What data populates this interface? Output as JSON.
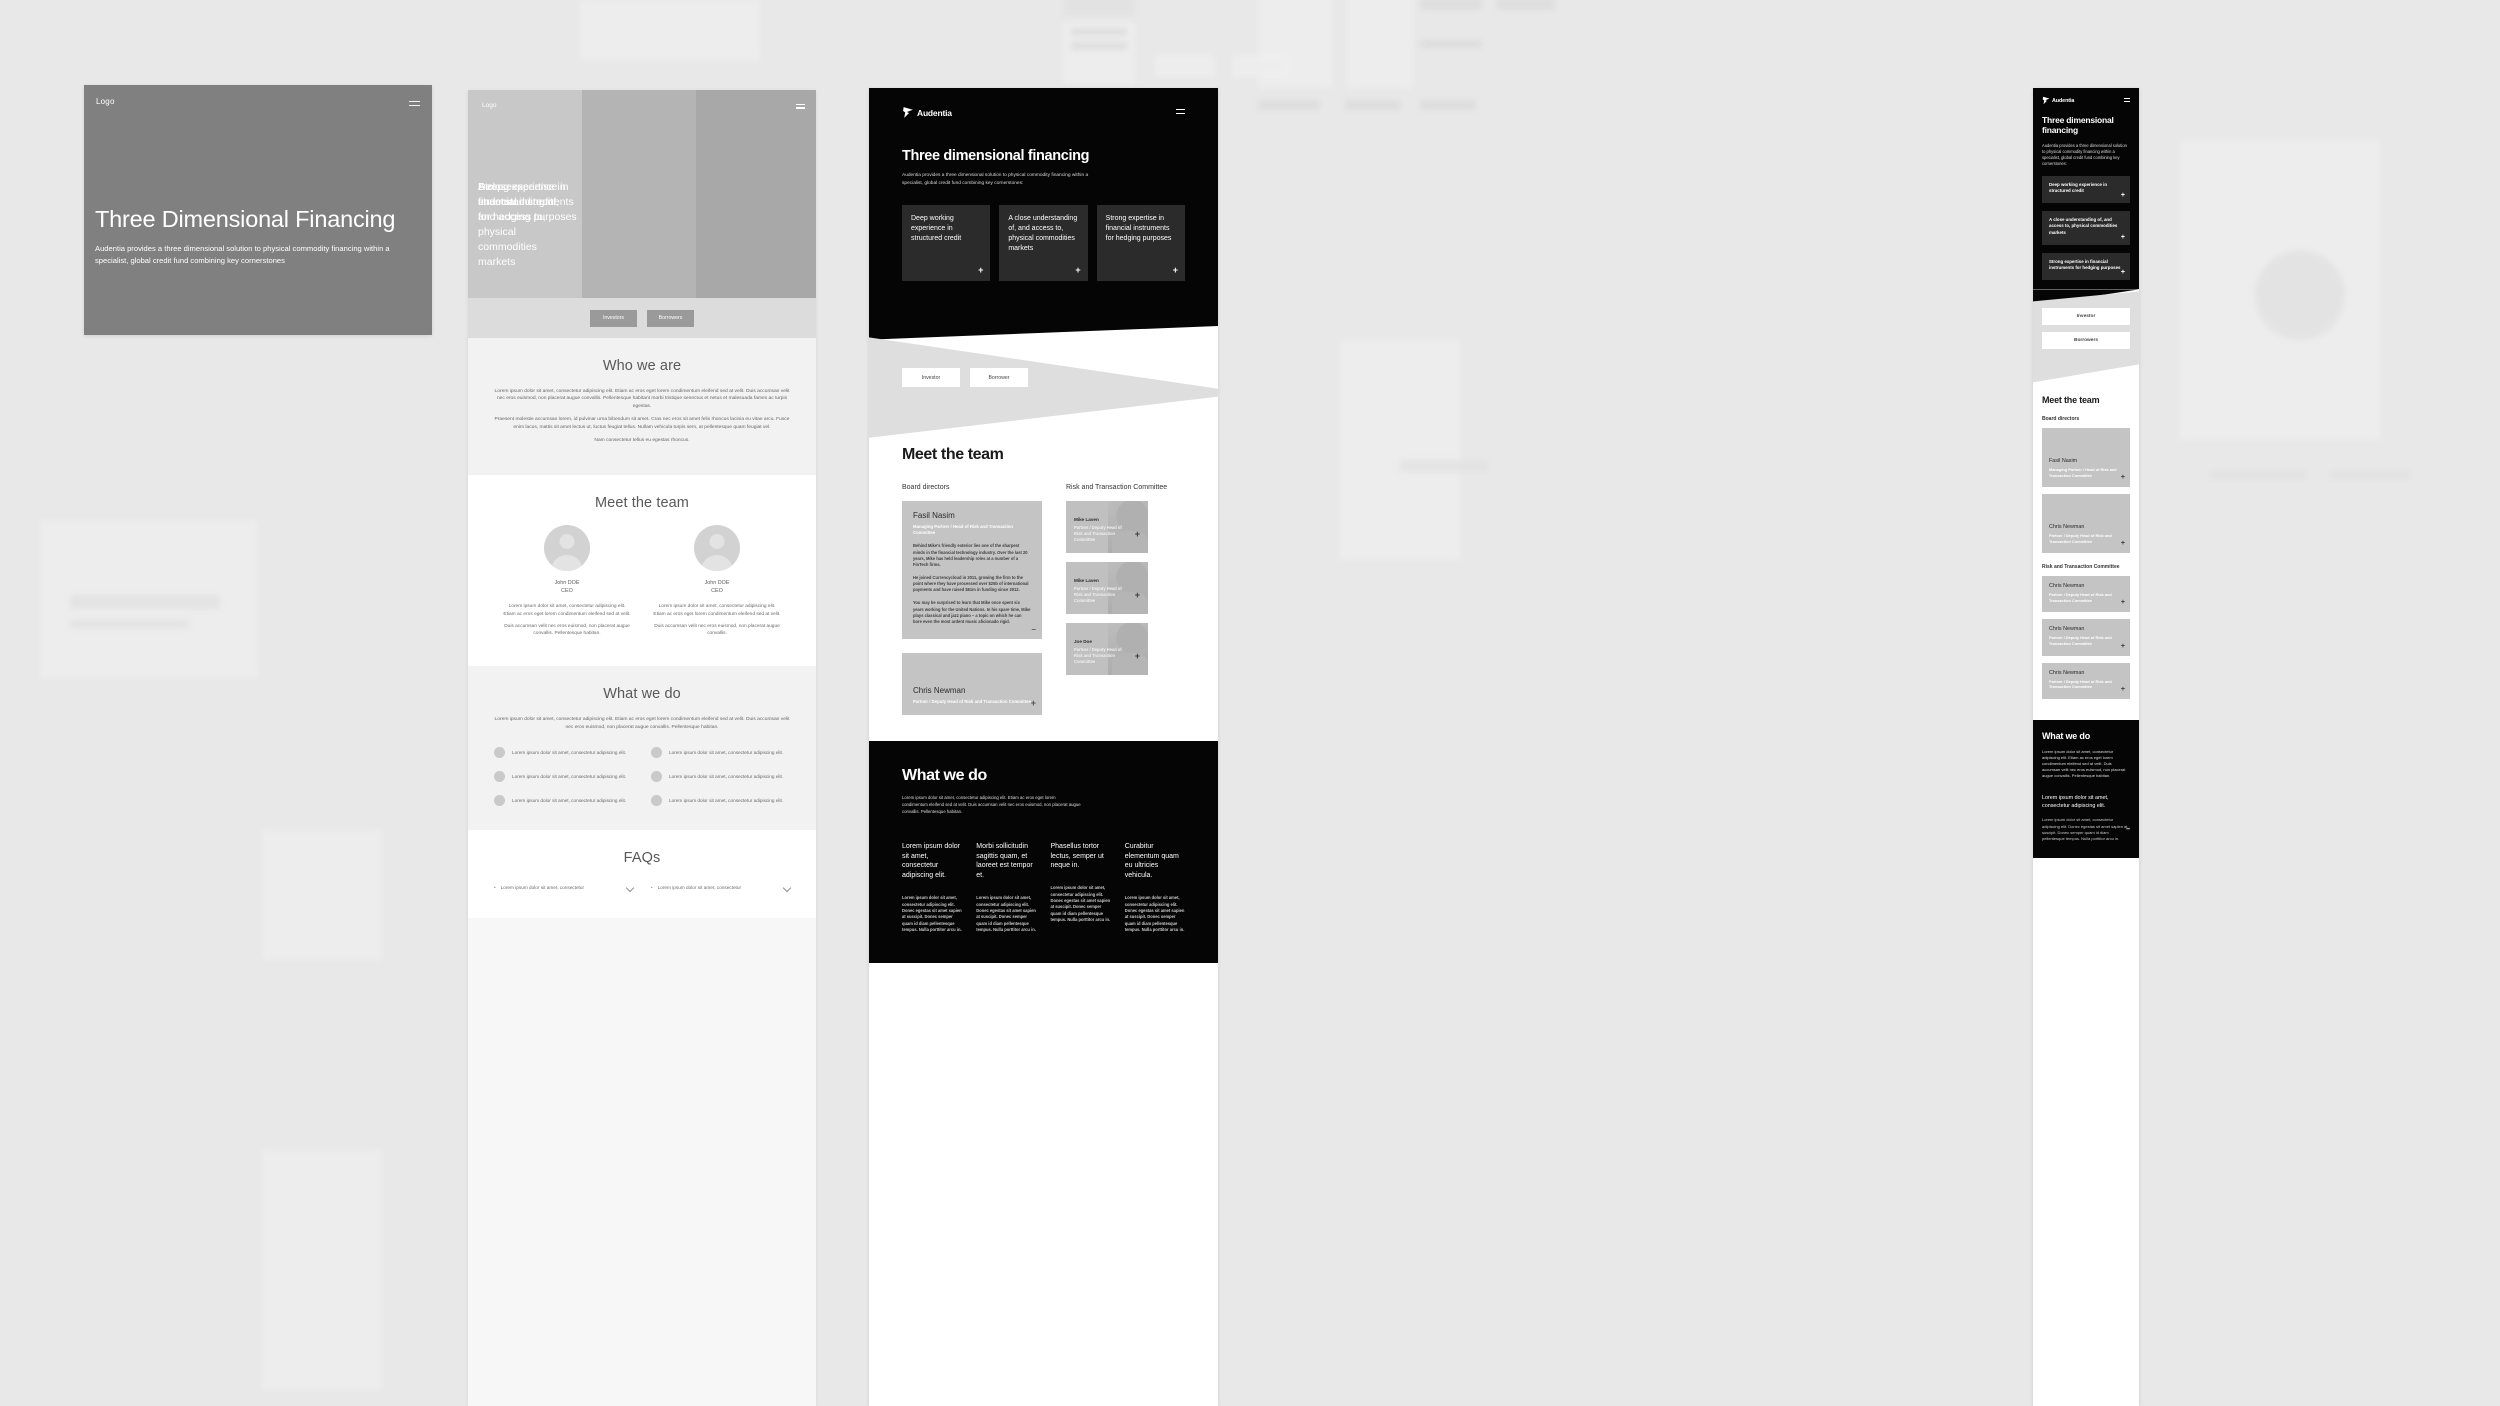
{
  "hero_desktop": {
    "logo": "Logo",
    "menu_icon": "hamburger-menu-icon",
    "title": "Three Dimensional Financing",
    "subtitle": "Audentia provides a three dimensional solution to physical commodity financing within a specialist, global credit fund combining key cornerstones"
  },
  "tablet": {
    "logo": "Logo",
    "menu_icon": "hamburger-menu-icon",
    "columns": [
      "Deep experience in structured credit",
      "A close understanding of, and access to, physical commodities markets",
      "Strong expertise in financial instruments for hedging purposes"
    ],
    "cta": {
      "investors": "Investors",
      "borrowers": "Borrowers"
    },
    "who_we_are": {
      "heading": "Who we are",
      "paragraphs": [
        "Lorem ipsum dolor sit amet, consectetur adipiscing elit. Etiam ac eros eget lorem condimentum eleifend sed at velit. Duis accumsan velit nec eros euismod, non placerat augue convallis. Pellentesque habitant morbi tristique senectus et netus et malesuada fames ac turpis egestas.",
        "Praesent molestie accumsan lorem, id pulvinar urna bibendum sit amet. Cras nec eros sit amet felis rhoncus lacinia eu vitae arcu. Fusce enim lacus, mattis sit amet lectus ut, luctus feugiat tellus. Nullam vehicula turpis sem, at pellentesque quam feugiat vel.",
        "Nam consectetur tellus eu egestas rhoncus."
      ]
    },
    "meet_the_team": {
      "heading": "Meet the team",
      "members": [
        {
          "name": "John DOE",
          "role": "CEO",
          "bio1": "Lorem ipsum dolor sit amet, consectetur adipiscing elit. Etiam ac eros eget lorem condimentum eleifend sed at velit.",
          "bio2": "Duis accumsan velit nec eros euismod, non placerat augue convallis. Pellentesque habitan."
        },
        {
          "name": "John DOE",
          "role": "CEO",
          "bio1": "Lorem ipsum dolor sit amet, consectetur adipiscing elit. Etiam ac eros eget lorem condimentum eleifend sed at velit.",
          "bio2": "Duis accumsan velit nec eros euismod, non placerat augue convallis."
        }
      ]
    },
    "what_we_do": {
      "heading": "What we do",
      "lead": "Lorem ipsum dolor sit amet, consectetur adipiscing elit. Etiam ac eros eget lorem condimentum eleifend sed at velit. Duis accumsan velit nec eros euismod, non placerat augue convallis. Pellentesque habitan.",
      "bullets": [
        "Lorem ipsum dolor sit amet, consectetur adipiscing elit.",
        "Lorem ipsum dolor sit amet, consectetur adipiscing elit.",
        "Lorem ipsum dolor sit amet, consectetur adipiscing elit.",
        "Lorem ipsum dolor sit amet, consectetur adipiscing elit.",
        "Lorem ipsum dolor sit amet, consectetur adipiscing elit.",
        "Lorem ipsum dolor sit amet, consectetur adipiscing elit."
      ]
    },
    "faqs": {
      "heading": "FAQs",
      "items": [
        "Lorem ipsum dolor sit amet, consectetur",
        "Lorem ipsum dolor sit amet, consectetur"
      ]
    }
  },
  "desktop_dark": {
    "brand": "Audentia",
    "logo_icon": "audentia-bird-logo-icon",
    "menu_icon": "hamburger-menu-icon",
    "title": "Three dimensional financing",
    "subtitle": "Audentia provides a three dimensional solution to physical commodity financing within a specialist, global credit fund combining key cornerstones:",
    "cards": [
      "Deep working experience in structured credit",
      "A close understanding of, and access to, physical commodities markets",
      "Strong expertise in financial instruments for hedging purposes"
    ],
    "buttons": {
      "investor": "Investor",
      "borrower": "Borrower"
    },
    "team": {
      "heading": "Meet the team",
      "board_label": "Board directors",
      "risk_label": "Risk and Transaction Committee",
      "featured": {
        "name": "Fasil Nasim",
        "role": "Managing Partner / Head of Risk and Transaction Committee",
        "bio": [
          "Behind Mike's friendly exterior lies one of the sharpest minds in the financial technology industry. Over the last 20 years, Mike has held leadership roles at a number of a FinTech firms.",
          "He joined Currencycloud in 2011, growing the firm to the point where they have processed over $25b of international payments and have raised $61m in funding since 2012.",
          "You may be surprised to learn that Mike once spent six years working for the United Nations. In his spare time, Mike plays classical and jazz piano – a topic on which he can bore even the most ardent music aficionado rigid."
        ]
      },
      "board_second": {
        "name": "Chris Newman",
        "role": "Partner / Deputy Head of Risk and Transaction Committee"
      },
      "committee": [
        {
          "name": "Mike Laven",
          "role": "Partner / Deputy Head of Risk and Transaction Committee"
        },
        {
          "name": "Mike Laven",
          "role": "Partner / Deputy Head of Risk and Transaction Committee"
        },
        {
          "name": "Joe Doe",
          "role": "Partner / Deputy Head of Risk and Transaction Committee"
        }
      ]
    },
    "what_we_do": {
      "heading": "What we do",
      "lead": "Lorem ipsum dolor sit amet, consectetur adipiscing elit. Etiam ac eros eget lorem condimentum eleifend sed at velit. Duis accumsan velit nec eros euismod, non placerat augue convallis. Pellentesque habitan.",
      "items": [
        {
          "title": "Lorem ipsum dolor sit amet, consectetur adipiscing elit.",
          "body": "Lorem ipsum dolor sit amet, consectetur adipiscing elit. Donec egestas sit amet sapien at suscipit. Donec semper quam id diam pellentesque tempus. Nulla porttitor arcu in."
        },
        {
          "title": "Morbi sollicitudin sagittis quam, et laoreet est tempor et.",
          "body": "Lorem ipsum dolor sit amet, consectetur adipiscing elit. Donec egestas sit amet sapien at suscipit. Donec semper quam id diam pellentesque tempus. Nulla porttitor arcu in."
        },
        {
          "title": "Phasellus tortor lectus, semper ut neque in.",
          "body": "Lorem ipsum dolor sit amet, consectetur adipiscing elit. Donec egestas sit amet sapien at suscipit. Donec semper quam id diam pellentesque tempus. Nulla porttitor arcu in."
        },
        {
          "title": "Curabitur elementum quam eu ultricies vehicula.",
          "body": "Lorem ipsum dolor sit amet, consectetur adipiscing elit. Donec egestas sit amet sapien at suscipit. Donec semper quam id diam pellentesque tempus. Nulla porttitor arcu in."
        }
      ]
    }
  },
  "mobile_dark": {
    "brand": "Audentia",
    "logo_icon": "audentia-bird-logo-icon",
    "menu_icon": "hamburger-menu-icon",
    "title": "Three dimensional financing",
    "subtitle": "Audentia provides a three dimensional solution to physical commodity financing within a specialist, global credit fund combining key cornerstones:",
    "accordions": [
      "Deep working experience in structured credit",
      "A close understanding of, and access to, physical commodities markets",
      "Strong expertise in financial instruments for hedging purposes"
    ],
    "buttons": {
      "investor": "Investor",
      "borrowers": "Borrowers"
    },
    "team": {
      "heading": "Meet the team",
      "board_label": "Board directors",
      "risk_label": "Risk and Transaction Committee",
      "board": [
        {
          "name": "Fasil Nasim",
          "role": "Managing Partner / Head of Risk and Transaction Committee"
        },
        {
          "name": "Chris Newman",
          "role": "Partner / Deputy Head of Risk and Transaction Committee"
        }
      ],
      "committee": [
        {
          "name": "Chris Newman",
          "role": "Partner / Deputy Head of Risk and Transaction Committee"
        },
        {
          "name": "Chris Newman",
          "role": "Partner / Deputy Head of Risk and Transaction Committee"
        },
        {
          "name": "Chris Newman",
          "role": "Partner / Deputy Head of Risk and Transaction Committee"
        }
      ]
    },
    "what_we_do": {
      "heading": "What we do",
      "lead": "Lorem ipsum dolor sit amet, consectetur adipiscing elit. Etiam ac eros eget lorem condimentum eleifend sed at velit. Duis accumsan velit nec eros euismod, non placerat augue convallis. Pellentesque habitan.",
      "item_title": "Lorem ipsum dolor sit amet, consectetur adipiscing elit.",
      "item_body": "Lorem ipsum dolor sit amet, consectetur adipiscing elit. Donec egestas sit amet sapien at suscipit. Donec semper quam id diam pellentesque tempus. Nulla porttitor arcu in."
    }
  },
  "colors": {
    "canvas": "#e8e8e8",
    "hero_grey": "#808080",
    "dark": "#050505",
    "card_dark": "#2b2b2b",
    "card_grey": "#c4c4c4",
    "band_grey": "#dedede"
  }
}
